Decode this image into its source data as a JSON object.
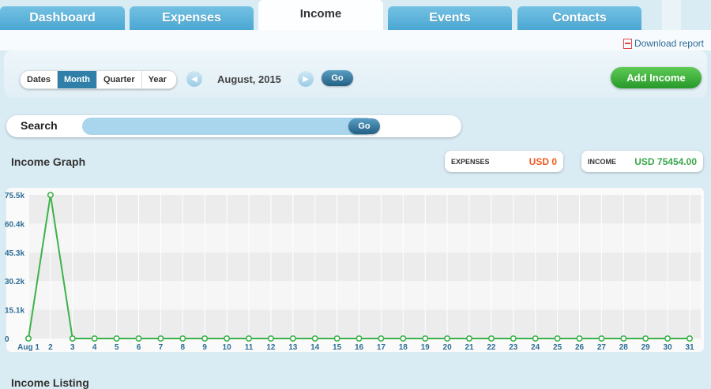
{
  "tabs": [
    {
      "label": "Dashboard",
      "active": false
    },
    {
      "label": "Expenses",
      "active": false
    },
    {
      "label": "Income",
      "active": true
    },
    {
      "label": "Events",
      "active": false
    },
    {
      "label": "Contacts",
      "active": false
    }
  ],
  "download_label": "Download report",
  "period_buttons": [
    {
      "label": "Dates",
      "active": false
    },
    {
      "label": "Month",
      "active": true
    },
    {
      "label": "Quarter",
      "active": false
    },
    {
      "label": "Year",
      "active": false
    }
  ],
  "period_text": "August, 2015",
  "go_label": "Go",
  "add_income_label": "Add Income",
  "search": {
    "label": "Search",
    "value": "",
    "go_label": "Go"
  },
  "graph_title": "Income Graph",
  "summary": {
    "expenses_label": "EXPENSES",
    "expenses_value": "USD 0",
    "income_label": "INCOME",
    "income_value": "USD 75454.00"
  },
  "listing_title": "Income Listing",
  "colors": {
    "expenses": "#f05a1e",
    "income": "#3aa64a",
    "line": "#3db24a",
    "accent": "#2f7fa9"
  },
  "chart_data": {
    "type": "line",
    "x": [
      "Aug 1",
      "2",
      "3",
      "4",
      "5",
      "6",
      "7",
      "8",
      "9",
      "10",
      "11",
      "12",
      "13",
      "14",
      "15",
      "16",
      "17",
      "18",
      "19",
      "20",
      "21",
      "22",
      "23",
      "24",
      "25",
      "26",
      "27",
      "28",
      "29",
      "30",
      "31"
    ],
    "series": [
      {
        "values": [
          0,
          75454,
          0,
          0,
          0,
          0,
          0,
          0,
          0,
          0,
          0,
          0,
          0,
          0,
          0,
          0,
          0,
          0,
          0,
          0,
          0,
          0,
          0,
          0,
          0,
          0,
          0,
          0,
          0,
          0,
          0
        ]
      }
    ],
    "yticks": [
      "0",
      "15.1k",
      "30.2k",
      "45.3k",
      "60.4k",
      "75.5k"
    ],
    "ylim": [
      0,
      75500
    ],
    "title": "",
    "xlabel": "",
    "ylabel": "",
    "grid": true
  }
}
